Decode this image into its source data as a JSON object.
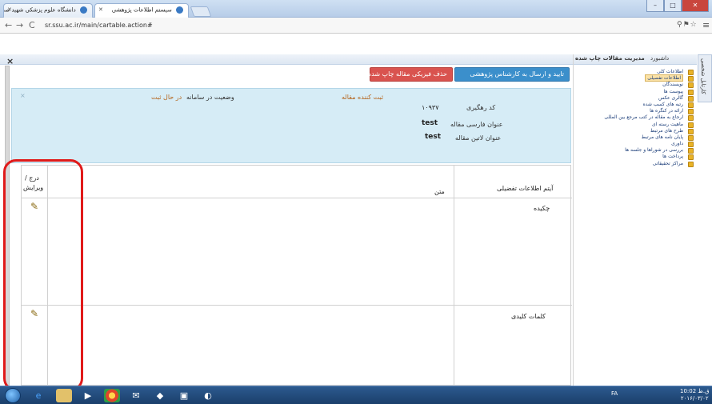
{
  "browser": {
    "tabs": [
      {
        "label": "دانشگاه علوم پزشکی شهید صدوقی"
      },
      {
        "label": "سیستم اطلاعات پژوهشی"
      }
    ],
    "url": "sr.ssu.ac.ir/main/cartable.action#",
    "window_controls": {
      "minimize": "–",
      "maximize": "□",
      "close": "✕"
    }
  },
  "page": {
    "close_label": "×",
    "vertical_tab": "کارتابل شخصی"
  },
  "sidebar": {
    "tabs": {
      "dashboard": "داشبورد",
      "manage": "مدیریت مقالات چاپ شده"
    },
    "items": [
      {
        "label": "اطلاعات کلی"
      },
      {
        "label": "اطلاعات تفصیلی",
        "active": true
      },
      {
        "label": "نویسندگان"
      },
      {
        "label": "پیوست ها"
      },
      {
        "label": "گالری عکس"
      },
      {
        "label": "رتبه های کسب شده"
      },
      {
        "label": "ارائه در کنگره ها"
      },
      {
        "label": "ارجاع به مقاله در کتب مرجع بین المللی"
      },
      {
        "label": "ماهیت رسته ای"
      },
      {
        "label": "طرح های مرتبط"
      },
      {
        "label": "پایان نامه های مرتبط"
      },
      {
        "label": "داوری"
      },
      {
        "label": "بررسی در شوراها و جلسه ها"
      },
      {
        "label": "پرداخت ها"
      },
      {
        "label": "مراکز تحقیقاتی"
      }
    ]
  },
  "actions": {
    "confirm_send": "تایید و ارسال به کارشناس پژوهشی",
    "physical_delete": "حذف فیزیکی مقاله چاپ شده"
  },
  "info": {
    "dismiss": "×",
    "registrar_label": "ثبت کننده مقاله",
    "status_label": "وضعیت در سامانه",
    "status_value": "در حال ثبت",
    "tracking_label": "کد رهگیری",
    "tracking_value": "۱۰۹۳۷",
    "title_fa_label": "عنوان فارسی مقاله",
    "title_fa_value": "test",
    "title_en_label": "عنوان لاتین مقاله",
    "title_en_value": "test"
  },
  "table": {
    "headers": {
      "item": "آیتم اطلاعات تفضیلی",
      "text": "متن",
      "edit_line1": "درج /",
      "edit_line2": "ویرایش"
    },
    "rows": [
      {
        "item": "چکیده",
        "text": ""
      },
      {
        "item": "کلمات کلیدی",
        "text": ""
      }
    ]
  },
  "taskbar": {
    "lang": "FA",
    "time": "10:02 ق.ظ",
    "date": "۲۰۱۶/۰۳/۰۲"
  },
  "colors": {
    "primary_button": "#3b8fcb",
    "danger_button": "#d9534f",
    "info_panel": "#d6ecf6",
    "highlight": "#e01a1a"
  }
}
